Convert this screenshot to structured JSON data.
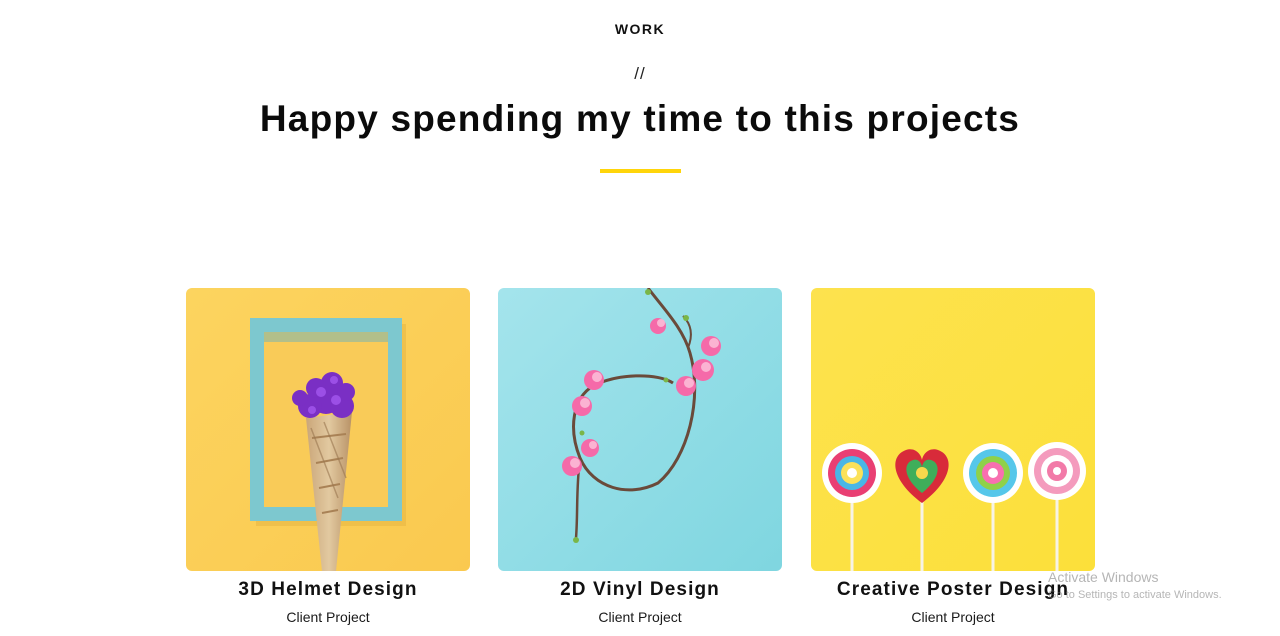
{
  "section": {
    "eyebrow": "WORK",
    "divider": "//",
    "headline": "Happy spending my time to this projects",
    "accent_color": "#ffd50a"
  },
  "projects": [
    {
      "title": "3D Helmet Design",
      "subtitle": "Client Project",
      "image": "flower-cone-in-frame",
      "background": "#fcd05c"
    },
    {
      "title": "2D Vinyl Design",
      "subtitle": "Client Project",
      "image": "flower-wreath",
      "background": "#8fdde6"
    },
    {
      "title": "Creative Poster Design",
      "subtitle": "Client Project",
      "image": "lollipops",
      "background": "#fde24a"
    }
  ],
  "watermark": {
    "line1": "Activate Windows",
    "line2": "Go to Settings to activate Windows."
  }
}
